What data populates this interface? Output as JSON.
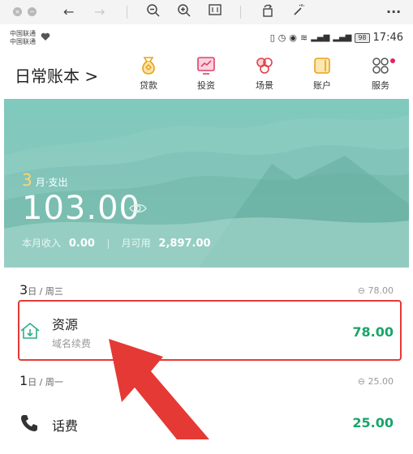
{
  "browser": {
    "back_icon": "arrow-left",
    "forward_icon": "arrow-right",
    "zoom_out_icon": "zoom-out",
    "zoom_in_icon": "zoom-in",
    "more_label": "···"
  },
  "status": {
    "carrier1": "中国联通",
    "carrier2": "中国联通",
    "battery": "98",
    "time": "17:46"
  },
  "header": {
    "title": "日常账本 >",
    "nav": [
      {
        "label": "贷款",
        "icon": "loan-icon"
      },
      {
        "label": "投资",
        "icon": "invest-icon"
      },
      {
        "label": "场景",
        "icon": "scene-icon"
      },
      {
        "label": "账户",
        "icon": "account-icon"
      },
      {
        "label": "服务",
        "icon": "service-icon"
      }
    ]
  },
  "summary": {
    "month": "3",
    "month_label": "月·支出",
    "amount": "103.00",
    "income_label": "本月收入",
    "income_value": "0.00",
    "available_label": "月可用",
    "available_value": "2,897.00"
  },
  "days": [
    {
      "day": "3",
      "weekday": "日 / 周三",
      "total": "⊖ 78.00",
      "entries": [
        {
          "name": "资源",
          "note": "域名续费",
          "amount": "78.00",
          "icon": "cloud-download-icon"
        }
      ]
    },
    {
      "day": "1",
      "weekday": "日 / 周一",
      "total": "⊖ 25.00",
      "entries": [
        {
          "name": "话费",
          "note": "",
          "amount": "25.00",
          "icon": "phone-icon"
        }
      ]
    }
  ],
  "colors": {
    "accent_green": "#19a56a",
    "highlight_red": "#e53935",
    "banner_teal": "#86c7bd",
    "month_yellow": "#ffd66a"
  }
}
